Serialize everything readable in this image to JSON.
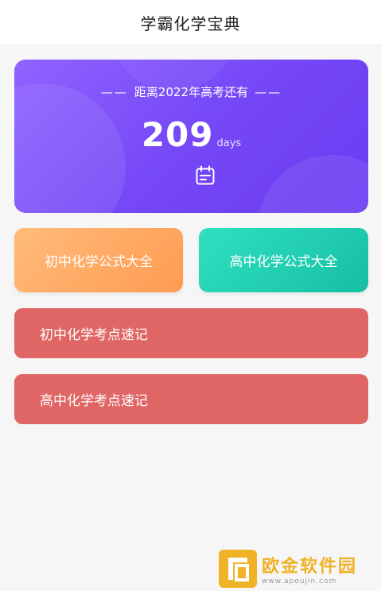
{
  "header": {
    "title": "学霸化学宝典"
  },
  "countdown": {
    "dash_left": "——",
    "label": "距离2022年高考还有",
    "dash_right": "——",
    "days": "209",
    "unit": "days",
    "icon": "calendar-icon"
  },
  "tiles": {
    "junior_formulas": "初中化学公式大全",
    "senior_formulas": "高中化学公式大全"
  },
  "bars": {
    "junior_points": "初中化学考点速记",
    "senior_points": "高中化学考点速记"
  },
  "watermark": {
    "name": "欧金软件园",
    "url": "www.apoujin.com"
  },
  "colors": {
    "countdown": "#7a4cf7",
    "tile_left": "#ffa55f",
    "tile_right": "#1ccfb2",
    "bars": "#e06565",
    "watermark": "#f0b226"
  }
}
